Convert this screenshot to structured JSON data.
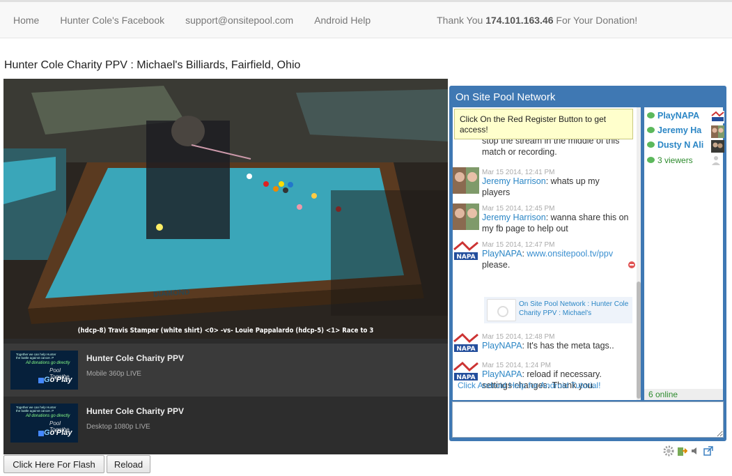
{
  "nav": {
    "home": "Home",
    "facebook": "Hunter Cole's Facebook",
    "email": "support@onsitepool.com",
    "android": "Android Help",
    "thanks_pre": "Thank You ",
    "thanks_ip": "174.101.163.46",
    "thanks_post": " For Your Donation!"
  },
  "page_title": "Hunter Cole Charity PPV : Michael's Billiards, Fairfield, Ohio",
  "video": {
    "caption": "(hdcp-8) Travis Stamper (white shirt) <0> -vs- Louie Pappalardo (hdcp-5) <1> Race to 3",
    "watermark": "DIAMOND"
  },
  "streams": [
    {
      "title": "Hunter Cole Charity PPV",
      "subtitle": "Mobile 360p LIVE"
    },
    {
      "title": "Hunter Cole Charity PPV",
      "subtitle": "Desktop 1080p LIVE"
    }
  ],
  "thumb": {
    "line1": "Together we can help Hunter",
    "line2": "the battle against cancer. P",
    "line3": "All donations go directly",
    "line4": "Pool Togethe",
    "logo_g": "G",
    "logo_rest": "o'Play"
  },
  "buttons": {
    "flash": "Click Here For Flash",
    "reload": "Reload"
  },
  "chat": {
    "title": "On Site Pool Network",
    "tooltip": "Click On the Red Register Button to get access!",
    "partial_text": "stop the stream in the middle of this match or recording.",
    "messages": [
      {
        "time": "Mar 15 2014, 12:41 PM",
        "name": "Jeremy Harrison",
        "text": ": whats up my players"
      },
      {
        "time": "Mar 15 2014, 12:45 PM",
        "name": "Jeremy Harrison",
        "text": ": wanna share this on my fb page to help out"
      },
      {
        "time": "Mar 15 2014, 12:47 PM",
        "name": "PlayNAPA",
        "link": "www.onsitepool.tv/ppv",
        "text": "please."
      },
      {
        "time": "Mar 15 2014, 12:48 PM",
        "name": "PlayNAPA",
        "text": ": It's has the meta tags.."
      },
      {
        "time": "Mar 15 2014, 1:24 PM",
        "name": "PlayNAPA",
        "text": ": reload if necessary. settings changes. Thank you."
      }
    ],
    "link_card": "On Site Pool Network : Hunter Cole Charity PPV : Michael's",
    "android_help": "Click Android Help for Android Tutorial!",
    "avatar_napa": "NAPA",
    "users": [
      "PlayNAPA",
      "Jeremy Ha",
      "Dusty N Ali"
    ],
    "viewers": "3 viewers",
    "online": "6 online"
  },
  "colors": {
    "chat_blue": "#3f78b3",
    "name_blue": "#2b86c5",
    "online_green": "#2e8b2e",
    "felt": "#3aa6b9"
  }
}
